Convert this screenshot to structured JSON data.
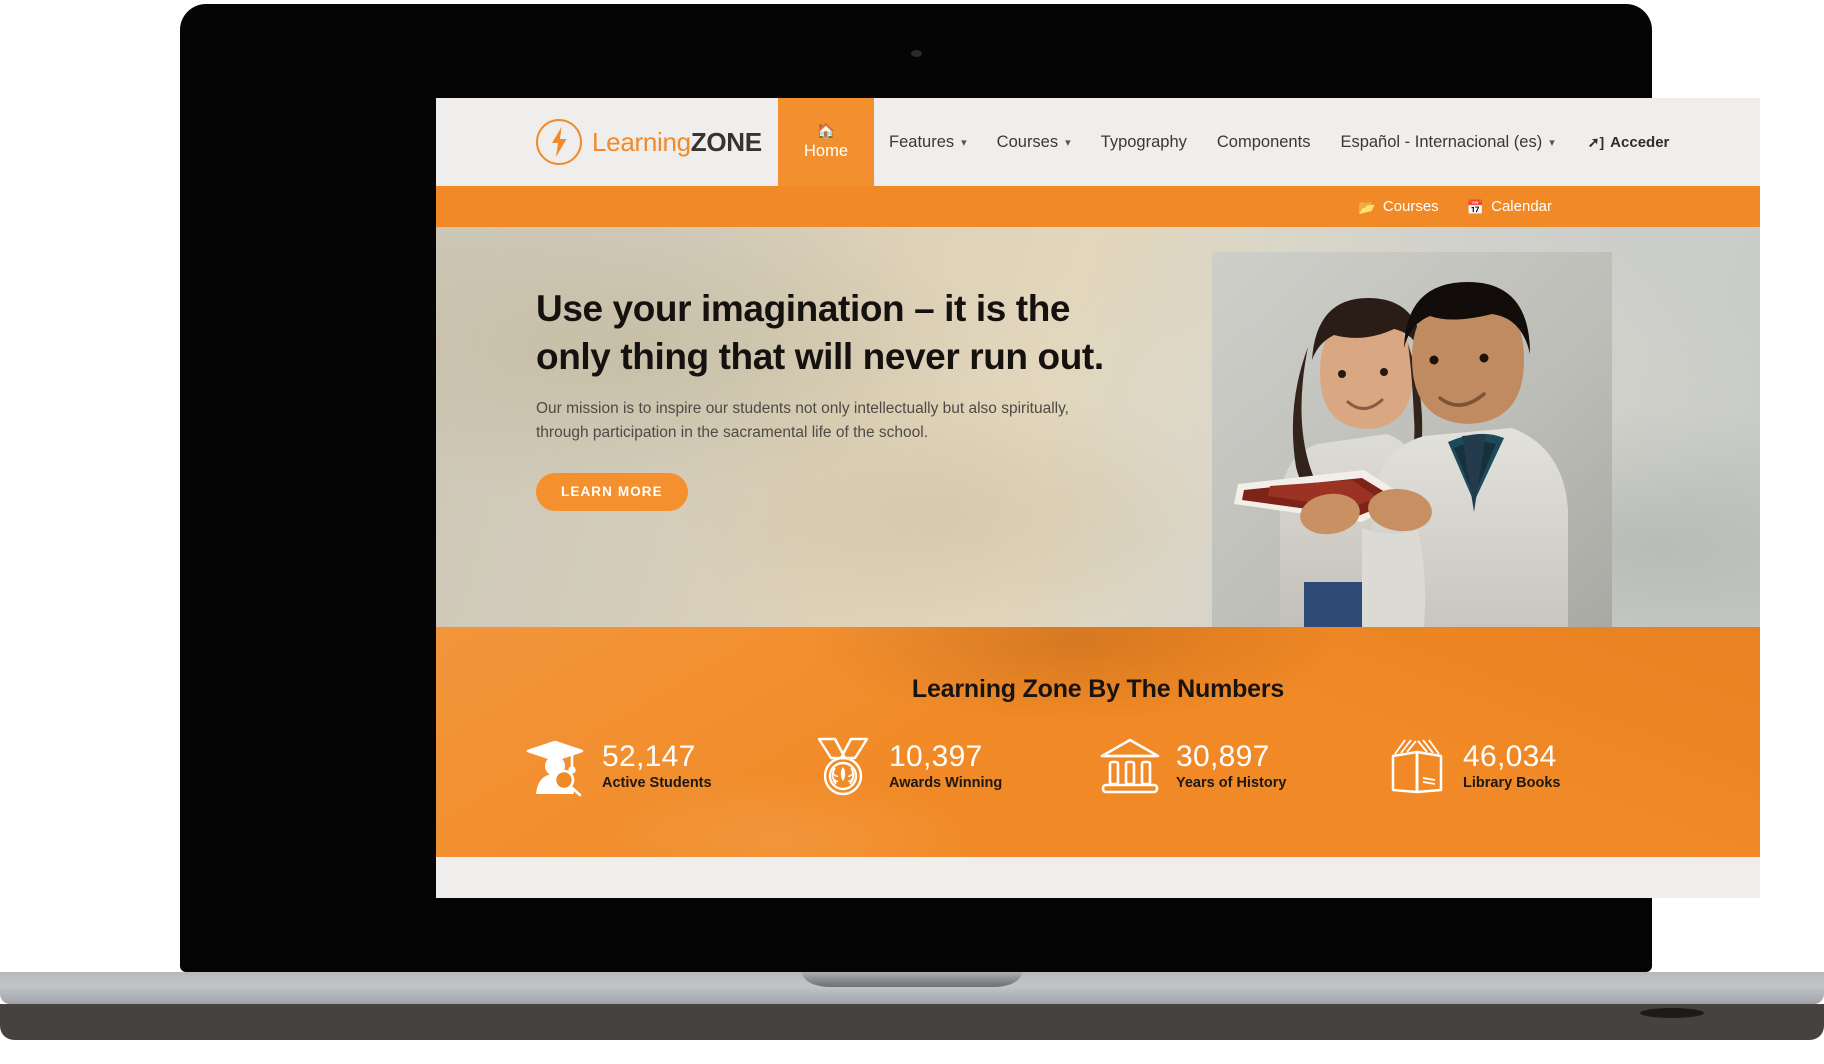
{
  "device": {
    "type": "laptop-mockup"
  },
  "header": {
    "logo": {
      "icon": "lightning-bolt-circle-icon",
      "text_primary": "Learning",
      "text_secondary": "ZONE"
    },
    "nav": [
      {
        "label": "Home",
        "icon": "home-icon",
        "active": true,
        "has_caret": false
      },
      {
        "label": "Features",
        "has_caret": true
      },
      {
        "label": "Courses",
        "has_caret": true
      },
      {
        "label": "Typography",
        "has_caret": false
      },
      {
        "label": "Components",
        "has_caret": false
      },
      {
        "label": "Español - Internacional (es)",
        "has_caret": true
      }
    ],
    "login": {
      "label": "Acceder",
      "icon": "sign-in-icon"
    }
  },
  "subnav": {
    "items": [
      {
        "label": "Courses",
        "icon": "folder-open-icon"
      },
      {
        "label": "Calendar",
        "icon": "calendar-icon"
      }
    ]
  },
  "hero": {
    "title_line1": "Use your imagination – it is the",
    "title_line2": "only thing that will never run out.",
    "subtitle_line1": "Our mission is to inspire our students not only intellectually but also spiritually,",
    "subtitle_line2": "through participation in the sacramental life of the school.",
    "cta_label": "LEARN MORE",
    "image_alt": "two-students-reading-book"
  },
  "stats": {
    "title": "Learning Zone By The Numbers",
    "items": [
      {
        "value": "52,147",
        "label": "Active Students",
        "icon": "graduate-search-icon"
      },
      {
        "value": "10,397",
        "label": "Awards Winning",
        "icon": "medal-icon"
      },
      {
        "value": "30,897",
        "label": "Years of History",
        "icon": "museum-icon"
      },
      {
        "value": "46,034",
        "label": "Library Books",
        "icon": "open-book-icon"
      }
    ]
  },
  "colors": {
    "brand_orange": "#f18a26",
    "header_bg": "#efeeec",
    "hero_title": "#14110f",
    "stat_number": "#ffffff",
    "stat_label": "#1d1814"
  }
}
